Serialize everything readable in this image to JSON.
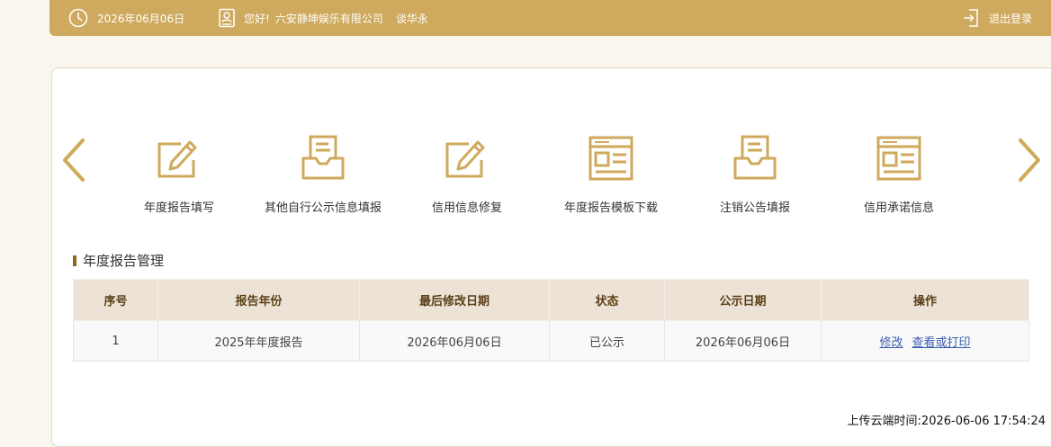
{
  "header": {
    "date": "2026年06月06日",
    "greeting": "您好!",
    "company": "六安静坤娱乐有限公司",
    "user": "谈华永",
    "logout_label": "退出登录"
  },
  "colors": {
    "accent": "#cfa95d",
    "table_header_bg": "#ece3d6",
    "link": "#3a5fb0"
  },
  "quick_actions": [
    {
      "label": "年度报告填写",
      "icon": "edit-icon"
    },
    {
      "label": "其他自行公示信息填报",
      "icon": "inbox-document-icon"
    },
    {
      "label": "信用信息修复",
      "icon": "edit-icon"
    },
    {
      "label": "年度报告模板下载",
      "icon": "template-window-icon"
    },
    {
      "label": "注销公告填报",
      "icon": "inbox-document-icon"
    },
    {
      "label": "信用承诺信息",
      "icon": "template-window-icon"
    }
  ],
  "section": {
    "title": "年度报告管理"
  },
  "table": {
    "headers": [
      "序号",
      "报告年份",
      "最后修改日期",
      "状态",
      "公示日期",
      "操作"
    ],
    "rows": [
      {
        "index": "1",
        "year": "2025年年度报告",
        "modified": "2026年06月06日",
        "status": "已公示",
        "publish_date": "2026年06月06日",
        "actions": [
          "修改",
          "查看或打印"
        ]
      }
    ]
  },
  "footer": {
    "upload_time": "上传云端时间:2026-06-06 17:54:24"
  }
}
